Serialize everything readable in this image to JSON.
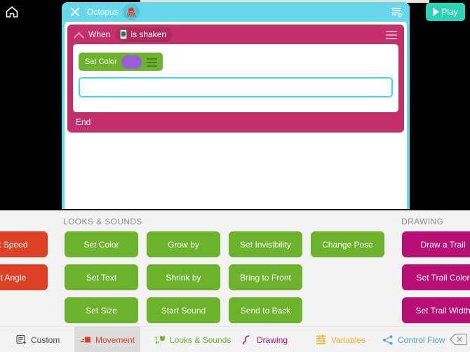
{
  "window": {
    "background": "#000000",
    "home_icon": "home-icon"
  },
  "toolbar": {
    "play_label": "Play",
    "play_icon": "play-triangle-icon",
    "play_color": "#2ed3b7"
  },
  "editor": {
    "accent_color": "#67d8ec",
    "close_icon": "close-icon",
    "object_name": "Octopus",
    "object_avatar_icon": "octopus-avatar-icon",
    "rules_list_icon": "rules-list-icon"
  },
  "script": {
    "rule": {
      "color": "#c4306b",
      "collapse_icon": "chevron-up-icon",
      "when_label": "When",
      "condition": {
        "icon": "device-shake-icon",
        "label": "is shaken"
      },
      "menu_icon": "hamburger-menu-icon",
      "end_label": "End",
      "blocks": [
        {
          "label": "Set Color",
          "color": "#6cb22c",
          "swatch_color": "#9b5cdb",
          "menu_icon": "hamburger-menu-icon"
        }
      ],
      "empty_slot": {
        "highlight_color": "#3fdcf0",
        "label": ""
      }
    }
  },
  "palette": {
    "background": "#f3f3f3",
    "categories": [
      {
        "name": "MOVEMENT",
        "heading_visible": false,
        "color": "#dd4125",
        "blocks": [
          "Set Speed",
          "Set Angle"
        ]
      },
      {
        "name": "LOOKS & SOUNDS",
        "heading_visible": true,
        "color": "#6cb22c",
        "blocks": [
          "Set Color",
          "Grow by",
          "Set Invisibility",
          "Change Pose",
          "Set Text",
          "Shrink by",
          "Bring to Front",
          "Set Size",
          "Start Sound",
          "Send to Back"
        ]
      },
      {
        "name": "DRAWING",
        "heading_visible": true,
        "color": "#b70f73",
        "blocks": [
          "Draw a Trail",
          "Set Trail Color",
          "Set Trail Width"
        ]
      }
    ]
  },
  "tabbar": {
    "tabs": [
      {
        "label": "Custom",
        "icon": "custom-block-icon",
        "color": "#4a4a4a",
        "active": false
      },
      {
        "label": "Movement",
        "icon": "movement-icon",
        "color": "#dd4125",
        "active": true
      },
      {
        "label": "Looks & Sounds",
        "icon": "looks-sounds-icon",
        "color": "#6cb22c",
        "active": false
      },
      {
        "label": "Drawing",
        "icon": "drawing-squiggle-icon",
        "color": "#b70f73",
        "active": false
      },
      {
        "label": "Variables",
        "icon": "variables-icon",
        "color": "#f0ad1e",
        "active": false
      },
      {
        "label": "Control Flow",
        "icon": "control-flow-icon",
        "color": "#4a9fe0",
        "active": false
      }
    ],
    "delete_icon": "delete-backspace-icon"
  }
}
